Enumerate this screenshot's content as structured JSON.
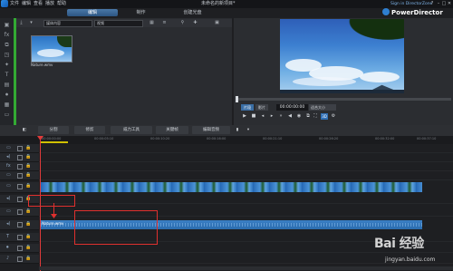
{
  "menu": {
    "items": [
      "文件",
      "编辑",
      "查看",
      "播放",
      "帮助"
    ],
    "document_title": "未命名的新项目*",
    "directorzone_link": "Sign in DirectorZone",
    "window_controls": [
      "?",
      "–",
      "□",
      "✕"
    ]
  },
  "brand": {
    "name": "PowerDirector"
  },
  "top_tabs": {
    "capture": "",
    "edit": "编辑",
    "produce": "制作",
    "create_disc": "创建光盘"
  },
  "left_toolbar": {
    "icons": [
      "media-room-icon",
      "fx-icon",
      "transition-icon",
      "pip-icon",
      "particle-icon",
      "title-icon",
      "mixing-icon",
      "voice-icon",
      "chapter-icon",
      "subtitle-icon"
    ]
  },
  "library": {
    "filter_select": "媒体内容",
    "type_select": "视频",
    "items": [
      {
        "label": "Nature.wmv"
      }
    ]
  },
  "preview": {
    "mode_clip": "片段",
    "mode_movie": "影片",
    "timecode": "00:00:00:00",
    "zoom": "适合大小"
  },
  "timeline_toolbar": {
    "split": "分割",
    "trim": "修剪",
    "power_tools": "威力工具",
    "keyframe": "关键帧",
    "edit_audio": "编辑音频"
  },
  "ruler": {
    "labels": [
      "00:00:00:00",
      "00:00:05:10",
      "00:00:10:20",
      "00:00:16:00",
      "00:00:21:10",
      "00:00:26:20",
      "00:00:32:00",
      "00:00:37:10",
      "00:00:42:20"
    ]
  },
  "tracks": {
    "audio_clip_label": "Nature.wmv"
  },
  "watermark": {
    "logo": "Bai 经验",
    "url": "jingyan.baidu.com"
  },
  "colors": {
    "accent": "#3a6ea5",
    "annotation": "#e0302e",
    "media_accent": "#33aa33",
    "clip_blue": "#2b6cae"
  }
}
